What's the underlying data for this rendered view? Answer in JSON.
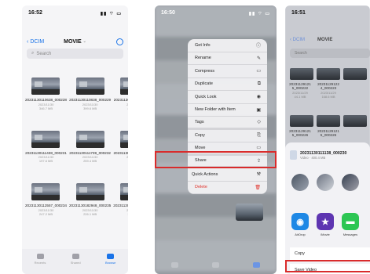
{
  "phone1": {
    "time": "16:52",
    "back_label": "DCIM",
    "title": "MOVIE",
    "search_placeholder": "Search",
    "files": [
      {
        "name": "20231130110638_000228",
        "date": "2023/11/30",
        "size": "346.7 MB"
      },
      {
        "name": "20231130110838_000229",
        "date": "2023/11/30",
        "size": "399.6 MB"
      },
      {
        "name": "20231130111138_000230",
        "date": "2023/11/30",
        "size": "400.4 MB"
      },
      {
        "name": "20231130111438_000231",
        "date": "2023/11/30",
        "size": "197.6 MB"
      },
      {
        "name": "20231130111739_000232",
        "date": "2023/11/30",
        "size": "259.4 MB"
      },
      {
        "name": "20231130112049_000233",
        "date": "2023/11/30",
        "size": "30 MB"
      },
      {
        "name": "20231130112557_000234",
        "date": "2023/11/30",
        "size": "247.2 MB"
      },
      {
        "name": "20231130182948_000235",
        "date": "2023/11/30",
        "size": "226.1 MB"
      },
      {
        "name": "20231130183247_000236",
        "date": "2023/11/30",
        "size": "167.9 MB"
      }
    ],
    "tabs": [
      {
        "label": "Recents",
        "icon": "clock-icon"
      },
      {
        "label": "Shared",
        "icon": "folder-shared-icon"
      },
      {
        "label": "Browse",
        "icon": "folder-icon",
        "active": true
      }
    ]
  },
  "phone2": {
    "time": "16:50",
    "menu": [
      {
        "label": "Get Info",
        "icon": "ⓘ"
      },
      {
        "label": "Rename",
        "icon": "✎"
      },
      {
        "label": "Compress",
        "icon": "▭"
      },
      {
        "label": "Duplicate",
        "icon": "⧉"
      },
      {
        "label": "Quick Look",
        "icon": "◉"
      },
      {
        "label": "New Folder with Item",
        "icon": "▣"
      },
      {
        "label": "Tags",
        "icon": "◇"
      },
      {
        "label": "Copy",
        "icon": "⎘"
      },
      {
        "label": "Move",
        "icon": "▭"
      },
      {
        "label": "Share",
        "icon": "⇪"
      },
      {
        "label": "Quick Actions",
        "icon": "⚒"
      },
      {
        "label": "Delete",
        "icon": "🗑"
      }
    ]
  },
  "phone3": {
    "time": "16:51",
    "back_label": "DCIM",
    "title": "MOVIE",
    "search_placeholder": "Search",
    "files_row1": [
      {
        "name": "20231129121",
        "name2": "5_000222",
        "date": "2023/11/29",
        "size": "44.1 MB"
      },
      {
        "name": "20231129122",
        "name2": "4_000223",
        "date": "2023/11/29",
        "size": "168.6 MB"
      }
    ],
    "files_row2": [
      {
        "name": "20231129121",
        "name2": "5_000226"
      },
      {
        "name": "20231129121",
        "name2": "5_000226"
      }
    ],
    "share_file_name": "20231130111138_000230",
    "share_file_size": "Video · 400.4 MB",
    "apps": [
      {
        "label": "AirDrop",
        "color": "#1e88e5"
      },
      {
        "label": "iMovie",
        "color": "#5e35b1"
      },
      {
        "label": "Messages",
        "color": "#2dc653"
      }
    ],
    "actions": [
      "Copy",
      "Save Video"
    ]
  }
}
